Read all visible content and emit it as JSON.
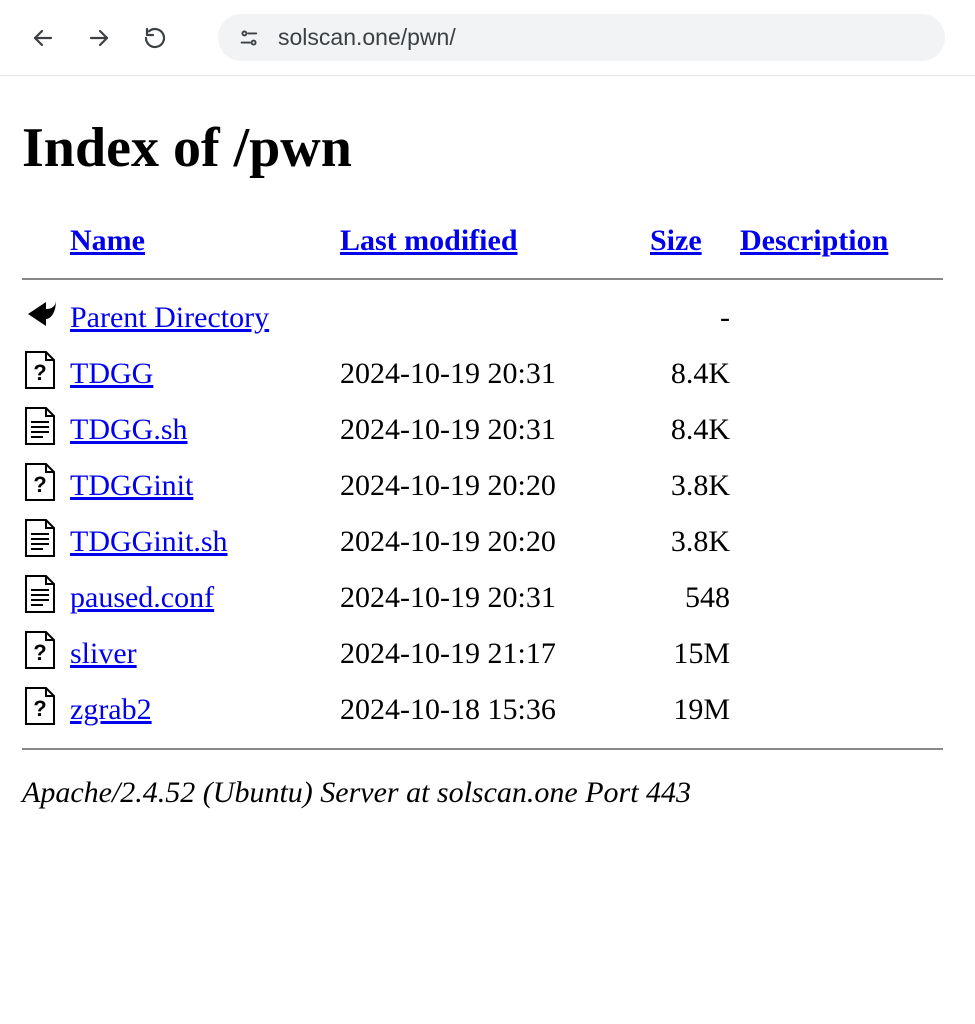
{
  "browser": {
    "url": "solscan.one/pwn/"
  },
  "page": {
    "title": "Index of /pwn"
  },
  "columns": {
    "name": "Name",
    "modified": "Last modified",
    "size": "Size",
    "description": "Description"
  },
  "parent": {
    "label": "Parent Directory",
    "size": "-"
  },
  "files": [
    {
      "icon": "unknown",
      "name": "TDGG",
      "modified": "2024-10-19 20:31",
      "size": "8.4K"
    },
    {
      "icon": "text",
      "name": "TDGG.sh",
      "modified": "2024-10-19 20:31",
      "size": "8.4K"
    },
    {
      "icon": "unknown",
      "name": "TDGGinit",
      "modified": "2024-10-19 20:20",
      "size": "3.8K"
    },
    {
      "icon": "text",
      "name": "TDGGinit.sh",
      "modified": "2024-10-19 20:20",
      "size": "3.8K"
    },
    {
      "icon": "text",
      "name": "paused.conf",
      "modified": "2024-10-19 20:31",
      "size": "548"
    },
    {
      "icon": "unknown",
      "name": "sliver",
      "modified": "2024-10-19 21:17",
      "size": "15M"
    },
    {
      "icon": "unknown",
      "name": "zgrab2",
      "modified": "2024-10-18 15:36",
      "size": "19M"
    }
  ],
  "footer": "Apache/2.4.52 (Ubuntu) Server at solscan.one Port 443"
}
